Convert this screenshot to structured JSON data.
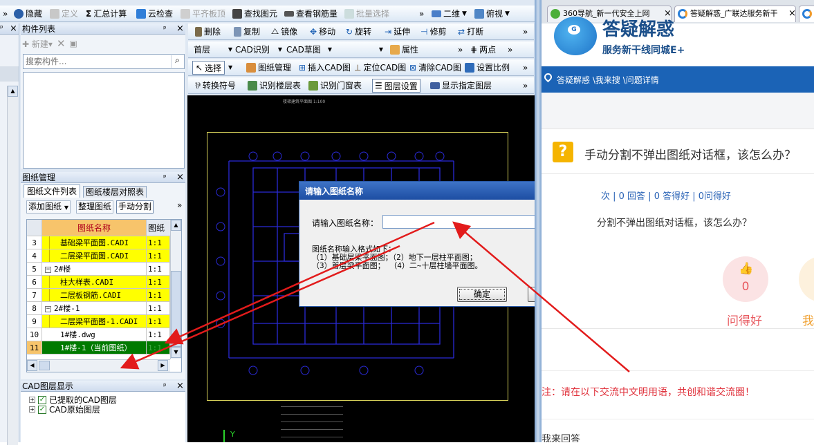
{
  "toolbar1": {
    "chevron": "»",
    "hide": "隐藏",
    "define": "定义",
    "summary": "汇总计算",
    "cloud_check": "云检查",
    "flat_board": "平齐板顶",
    "find_element": "查找图元",
    "view_rebar": "查看钢筋量",
    "batch_select": "批量选择",
    "chevron2": "»",
    "view2d": "二维",
    "view_top": "俯视"
  },
  "left_edge": {
    "pin": "ᵖ",
    "close": "×"
  },
  "comp_list": {
    "title": "构件列表",
    "pin": "ᵖ",
    "close": "×",
    "new_btn": "新建",
    "search_placeholder": "搜索构件..."
  },
  "drawing_mgr": {
    "title": "图纸管理",
    "pin": "ᵖ",
    "close": "×",
    "tab1": "图纸文件列表",
    "tab2": "图纸楼层对照表",
    "add_btn": "添加图纸",
    "organize_btn": "整理图纸",
    "split_btn": "手动分割",
    "chevron": "»",
    "col_name": "图纸名称",
    "col_ratio": "图纸比",
    "rows": [
      {
        "num": "3",
        "name": "基础梁平面图.CADI",
        "ratio": "1:1"
      },
      {
        "num": "4",
        "name": "二层梁平面图.CADI",
        "ratio": "1:1"
      },
      {
        "num": "5",
        "name": "2#楼",
        "ratio": "1:1"
      },
      {
        "num": "6",
        "name": "柱大样表.CADI",
        "ratio": "1:1"
      },
      {
        "num": "7",
        "name": "二层板钢筋.CADI",
        "ratio": "1:1"
      },
      {
        "num": "8",
        "name": "2#楼-1",
        "ratio": "1:1"
      },
      {
        "num": "9",
        "name": "二层梁平面图-1.CADI",
        "ratio": "1:1"
      },
      {
        "num": "10",
        "name": "1#楼.dwg",
        "ratio": "1:1"
      },
      {
        "num": "11",
        "name": "1#楼-1（当前图纸）",
        "ratio": "1:1"
      }
    ]
  },
  "cad_layers": {
    "title": "CAD图层显示",
    "pin": "ᵖ",
    "close": "×",
    "item1": "已提取的CAD图层",
    "item2": "CAD原始图层"
  },
  "tb_row1": {
    "delete": "删除",
    "copy": "复制",
    "mirror": "镜像",
    "move": "移动",
    "rotate": "旋转",
    "extend": "延伸",
    "trim": "修剪",
    "break": "打断",
    "chevron": "»"
  },
  "tb_row2": {
    "floor": "首层",
    "cad_recog": "CAD识别",
    "cad_sketch": "CAD草图",
    "attr": "属性",
    "chevron": "»",
    "two_point": "两点",
    "chevron2": "»"
  },
  "tb_row3": {
    "select": "选择",
    "drawing_mgmt": "图纸管理",
    "insert_cad": "插入CAD图",
    "locate_cad": "定位CAD图",
    "clear_cad": "清除CAD图",
    "set_scale": "设置比例",
    "chevron": "»"
  },
  "tb_row4": {
    "convert_symbol": "转换符号",
    "recog_floor_table": "识别楼层表",
    "recog_door_window": "识别门窗表",
    "layer_settings": "图层设置",
    "show_layer": "显示指定图层",
    "chevron": "»"
  },
  "canvas": {
    "top_note": "楼梯建筑平面图 1:100",
    "axis_y": "Y"
  },
  "dialog": {
    "title": "请输入图纸名称",
    "label": "请输入图纸名称：",
    "input_value": "",
    "hint_title": "图纸名称输入格式如下：",
    "hint_line1": "（1）基础层梁平面图；（2）地下一层柱平面图；",
    "hint_line2": "（3）首层梁平面图；  （4）二~十层柱墙平面图。",
    "ok": "确定",
    "cancel": "取消"
  },
  "browser": {
    "tab1": "360导航_新一代安全上网",
    "tab2": "答疑解惑_广联达服务新干",
    "close1": "×",
    "close2": "×",
    "brand_title": "答疑解惑",
    "brand_sub": "服务新干线同城E+",
    "breadcrumb": "答疑解惑 \\我来搜 \\问题详情",
    "question": "手动分割不弹出图纸对话框，该怎么办？",
    "stats": "次 | 0 回答 | 0 答得好 | 0问得好",
    "question_body": "分割不弹出图纸对话框，该怎么办？",
    "good_count": "0",
    "good_label": "问得好",
    "me_label": "我",
    "notice": "注：请在以下交流中文明用语，共创和谐交流圈！",
    "answer_label": "我来回答",
    "accent": "#1b63b6",
    "notice_color": "#e0323c"
  },
  "colors": {
    "highlight_yellow": "#ffff00",
    "row_green": "#007a00",
    "header_orange": "#f7c46b",
    "cad_blue": "#2a2ad8",
    "arrow_red": "#e21b1b"
  }
}
